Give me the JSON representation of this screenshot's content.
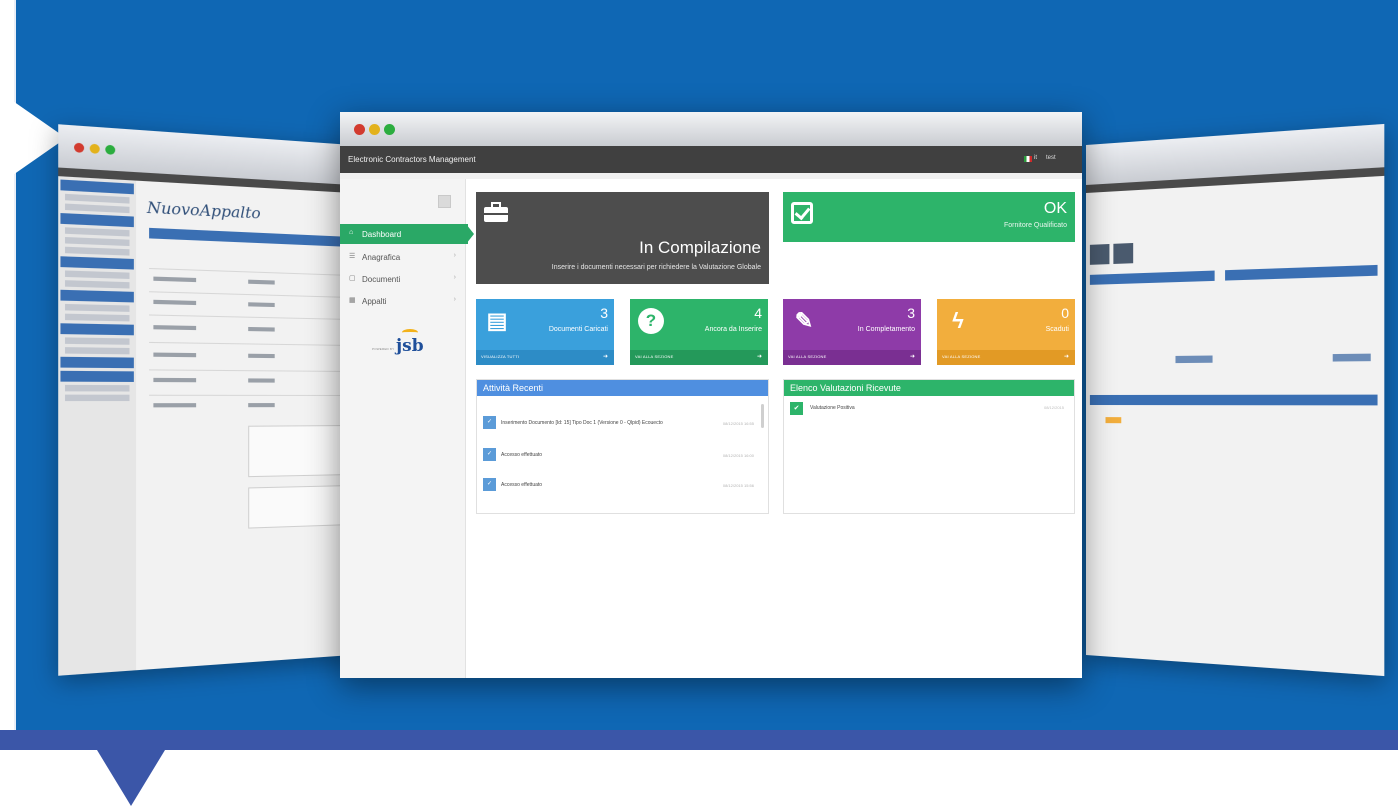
{
  "colors": {
    "background_blue": "#0f67b4",
    "band": "#3b56a8",
    "app_header": "#404040",
    "green": "#2db46a",
    "blue": "#3aa0dc",
    "purple": "#8e3ba8",
    "orange": "#f2ae3d",
    "panel_blue": "#4f8fe0",
    "panel_green": "#2db46a"
  },
  "left_window": {
    "page_title": "NuovoAppalto"
  },
  "main_window": {
    "app_title": "Electronic Contractors Management",
    "lang": "it",
    "user": "test"
  },
  "sidebar": {
    "items": [
      {
        "label": "Dashboard",
        "icon": "home-icon",
        "active": true
      },
      {
        "label": "Anagrafica",
        "icon": "list-icon"
      },
      {
        "label": "Documenti",
        "icon": "document-icon"
      },
      {
        "label": "Appalti",
        "icon": "grid-icon"
      }
    ],
    "logo_pre": "POWERED BY",
    "logo": "jsb"
  },
  "status_tile": {
    "title": "In Compilazione",
    "subtitle": "Inserire i documenti necessari per richiedere la Valutazione Globale",
    "icon": "briefcase-icon"
  },
  "ok_tile": {
    "value": "OK",
    "subtitle": "Fornitore Qualificato",
    "icon": "checkbox-icon"
  },
  "stat_tiles": [
    {
      "count": "3",
      "label": "Documenti Caricati",
      "link": "VISUALIZZA TUTTI",
      "icon": "book-icon",
      "color": "#3aa0dc",
      "footer": "#2d8cc6"
    },
    {
      "count": "4",
      "label": "Ancora da Inserire",
      "link": "VAI ALLA SEZIONE",
      "icon": "question-icon",
      "color": "#2db46a",
      "footer": "#24995a"
    },
    {
      "count": "3",
      "label": "In Completamento",
      "link": "VAI ALLA SEZIONE",
      "icon": "edit-icon",
      "color": "#8e3ba8",
      "footer": "#7a2f92"
    },
    {
      "count": "0",
      "label": "Scaduti",
      "link": "VAI ALLA SEZIONE",
      "icon": "bolt-icon",
      "color": "#f2ae3d",
      "footer": "#e29a25"
    }
  ],
  "activity_panel": {
    "title": "Attività Recenti",
    "rows": [
      {
        "text": "Inserimento Documento [Id: 15] Tipo Doc 1 (Versione 0 - Qlpid) Ecouecto",
        "date": "08/12/2015 16:55"
      },
      {
        "text": "Accesso effettuato",
        "date": "08/12/2015 16:00"
      },
      {
        "text": "Accesso effettuato",
        "date": "08/12/2015 15:56"
      }
    ]
  },
  "evaluations_panel": {
    "title": "Elenco Valutazioni Ricevute",
    "rows": [
      {
        "text": "Valutazione Positiva",
        "date": "08/12/2015"
      }
    ]
  }
}
